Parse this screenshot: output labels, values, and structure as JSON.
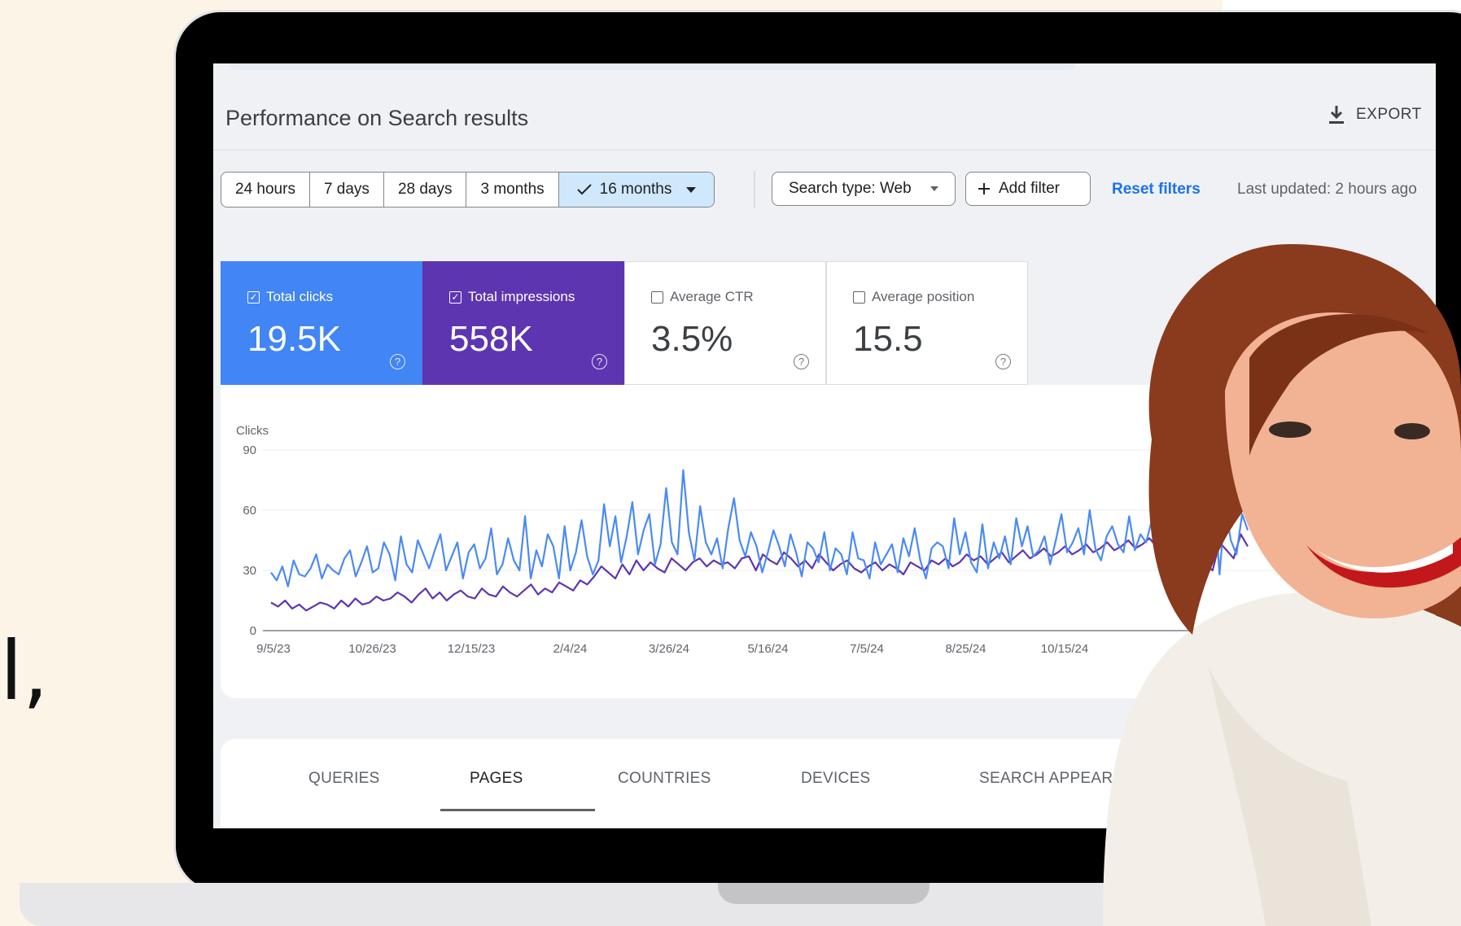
{
  "side_text": "l,",
  "header": {
    "title": "Performance on Search results",
    "export_label": "EXPORT"
  },
  "date_ranges": [
    {
      "label": "24 hours"
    },
    {
      "label": "7 days"
    },
    {
      "label": "28 days"
    },
    {
      "label": "3 months"
    },
    {
      "label": "16 months",
      "selected": true
    }
  ],
  "filters": {
    "search_type": "Search type: Web",
    "add_filter": "Add filter",
    "reset": "Reset filters",
    "last_updated": "Last updated: 2 hours ago"
  },
  "metrics": [
    {
      "label": "Total clicks",
      "value": "19.5K",
      "checked": true,
      "color": "#4285f4"
    },
    {
      "label": "Total impressions",
      "value": "558K",
      "checked": true,
      "color": "#5e35b1"
    },
    {
      "label": "Average CTR",
      "value": "3.5%",
      "checked": false
    },
    {
      "label": "Average position",
      "value": "15.5",
      "checked": false
    }
  ],
  "chart_data": {
    "type": "line",
    "ylabel": "Clicks",
    "ylim": [
      0,
      90
    ],
    "y_ticks": [
      "90",
      "60",
      "30",
      "0"
    ],
    "x_ticks": [
      "9/5/23",
      "10/26/23",
      "12/15/23",
      "2/4/24",
      "3/26/24",
      "5/16/24",
      "7/5/24",
      "8/25/24",
      "10/15/24"
    ],
    "series": [
      {
        "color": "#4a8af4",
        "values": [
          29,
          25,
          32,
          22,
          35,
          28,
          27,
          31,
          38,
          26,
          33,
          30,
          28,
          36,
          40,
          27,
          34,
          42,
          29,
          31,
          44,
          38,
          25,
          47,
          33,
          29,
          45,
          38,
          31,
          40,
          48,
          30,
          37,
          44,
          26,
          39,
          43,
          31,
          36,
          51,
          28,
          33,
          46,
          35,
          30,
          57,
          26,
          40,
          32,
          48,
          42,
          26,
          52,
          30,
          39,
          55,
          37,
          28,
          35,
          63,
          42,
          57,
          34,
          47,
          64,
          38,
          50,
          58,
          33,
          43,
          71,
          44,
          38,
          80,
          49,
          35,
          62,
          44,
          38,
          46,
          31,
          51,
          66,
          45,
          37,
          49,
          42,
          29,
          39,
          50,
          42,
          32,
          48,
          39,
          27,
          44,
          41,
          34,
          49,
          30,
          41,
          38,
          28,
          49,
          36,
          35,
          26,
          44,
          33,
          38,
          43,
          29,
          46,
          37,
          51,
          35,
          26,
          41,
          44,
          42,
          31,
          56,
          38,
          49,
          34,
          29,
          53,
          31,
          44,
          36,
          47,
          33,
          56,
          42,
          52,
          37,
          40,
          47,
          33,
          45,
          58,
          39,
          44,
          51,
          38,
          60,
          41,
          35,
          47,
          52,
          43,
          39,
          57,
          40,
          48,
          44,
          55,
          42,
          58,
          47,
          63,
          38,
          52,
          50,
          67,
          45,
          56,
          70,
          28,
          62,
          45,
          38,
          58,
          50
        ],
        "pos_hint": "each value is in clicks"
      },
      {
        "color": "#5e35b1",
        "values": [
          14,
          12,
          15,
          11,
          13,
          10,
          12,
          14,
          13,
          11,
          15,
          12,
          16,
          13,
          14,
          17,
          15,
          16,
          19,
          17,
          14,
          18,
          21,
          16,
          19,
          15,
          18,
          20,
          17,
          16,
          21,
          18,
          17,
          22,
          19,
          17,
          20,
          23,
          18,
          21,
          19,
          24,
          22,
          20,
          25,
          23,
          27,
          32,
          29,
          26,
          33,
          28,
          35,
          30,
          34,
          31,
          29,
          36,
          33,
          30,
          34,
          36,
          32,
          35,
          33,
          34,
          31,
          36,
          37,
          30,
          38,
          35,
          33,
          39,
          36,
          32,
          35,
          31,
          38,
          34,
          30,
          33,
          35,
          31,
          29,
          32,
          34,
          30,
          33,
          31,
          28,
          34,
          32,
          30,
          35,
          33,
          36,
          32,
          34,
          38,
          35,
          37,
          33,
          36,
          39,
          34,
          37,
          40,
          36,
          38,
          41,
          37,
          39,
          42,
          38,
          40,
          43,
          39,
          41,
          44,
          40,
          42,
          45,
          41,
          43,
          46,
          42,
          44,
          47,
          43,
          45,
          41,
          37,
          33,
          30,
          44,
          40,
          36,
          48,
          42
        ]
      }
    ]
  }
}
